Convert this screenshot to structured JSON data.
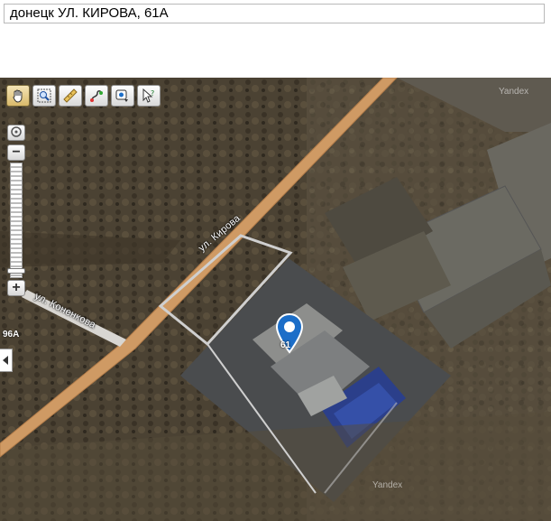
{
  "search": {
    "value": "донецк  УЛ. КИРОВА, 61А"
  },
  "map": {
    "streets": {
      "kirova": "ул. Кирова",
      "konenkova": "ул. Коненкова"
    },
    "house_numbers": {
      "left": "96А",
      "marker": "61"
    },
    "watermarks": [
      "Yandex",
      "Yandex"
    ]
  },
  "toolbar": {
    "tools": [
      {
        "icon": "hand-icon"
      },
      {
        "icon": "zoom-area-icon"
      },
      {
        "icon": "ruler-icon"
      },
      {
        "icon": "route-icon"
      },
      {
        "icon": "add-placemark-icon"
      },
      {
        "icon": "help-cursor-icon"
      }
    ]
  },
  "zoom": {
    "in_label": "+",
    "out_label": "−",
    "level": 0.95
  },
  "colors": {
    "road": "#cf9a64",
    "marker": "#1c6ec8"
  }
}
